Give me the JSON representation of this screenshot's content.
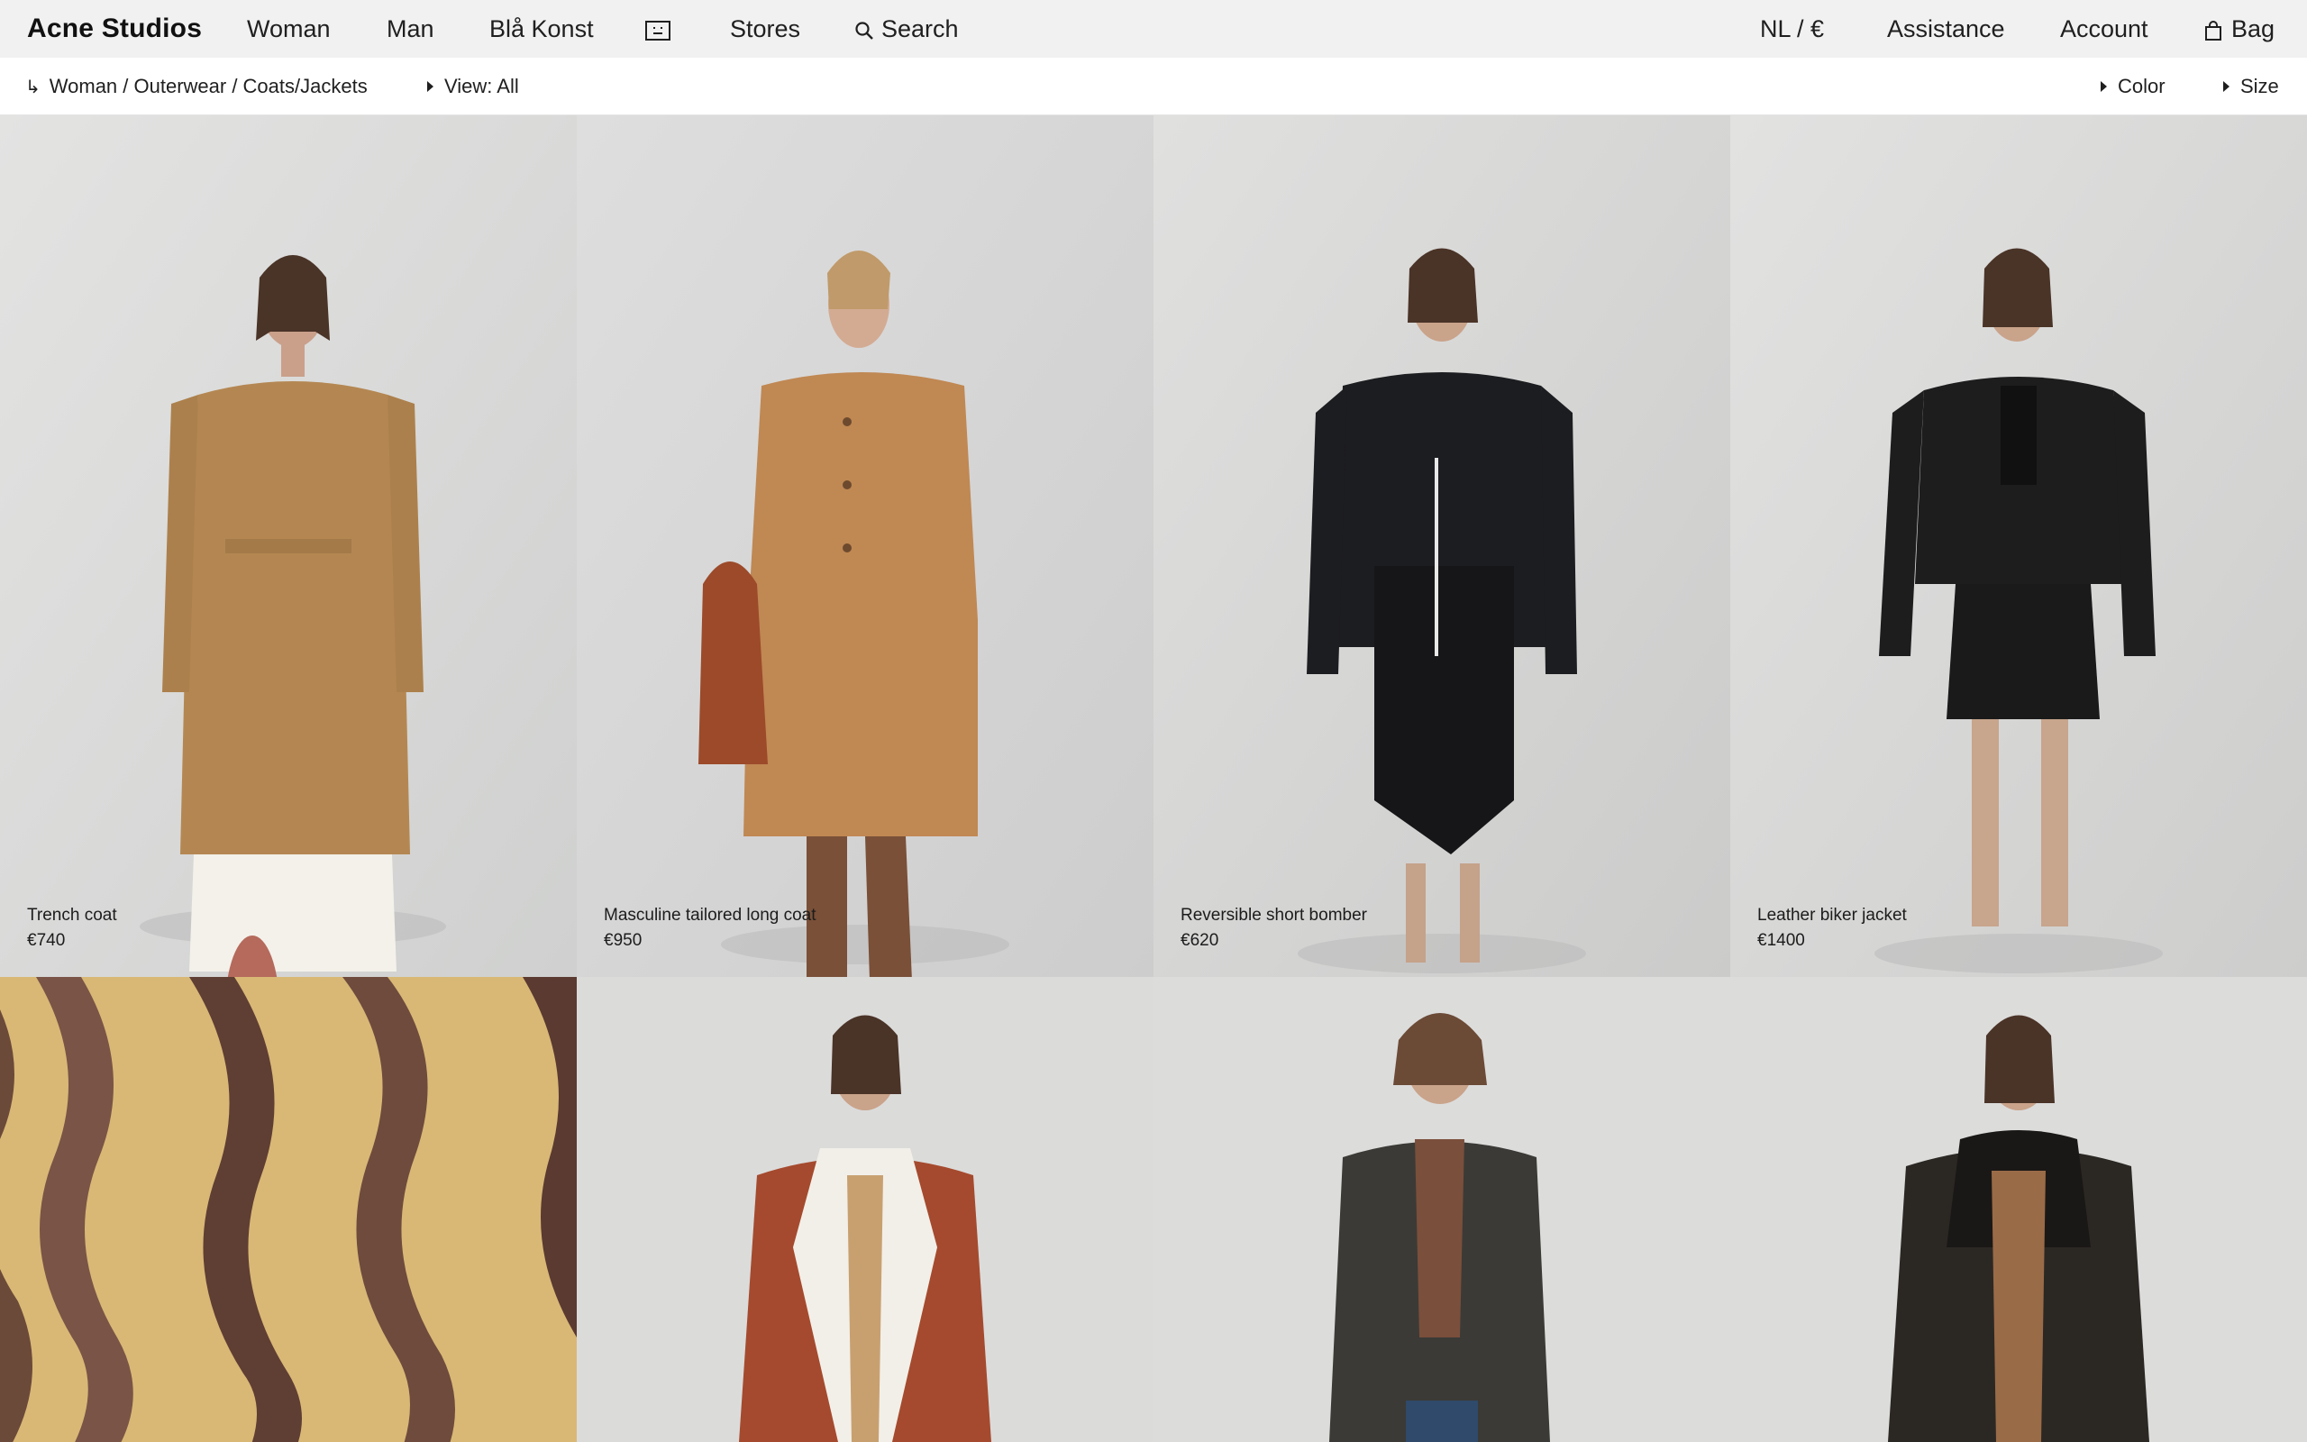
{
  "nav": {
    "brand": "Acne Studios",
    "left_items": [
      {
        "label": "Woman"
      },
      {
        "label": "Man"
      },
      {
        "label": "Blå Konst"
      }
    ],
    "face_icon": "face-icon",
    "stores": "Stores",
    "search": "Search",
    "locale": "NL / €",
    "assistance": "Assistance",
    "account": "Account",
    "bag": "Bag"
  },
  "subbar": {
    "breadcrumb": "Woman / Outerwear / Coats/Jackets",
    "view": "View: All",
    "color": "Color",
    "size": "Size"
  },
  "products": [
    {
      "name": "Trench coat",
      "price": "€740"
    },
    {
      "name": "Masculine tailored long coat",
      "price": "€950"
    },
    {
      "name": "Reversible short bomber",
      "price": "€620"
    },
    {
      "name": "Leather biker jacket",
      "price": "€1400"
    }
  ],
  "colors": {
    "nav_bg": "#f1f1f1",
    "photo_bg": "#dcdcdc",
    "text": "#1f1f1f"
  }
}
